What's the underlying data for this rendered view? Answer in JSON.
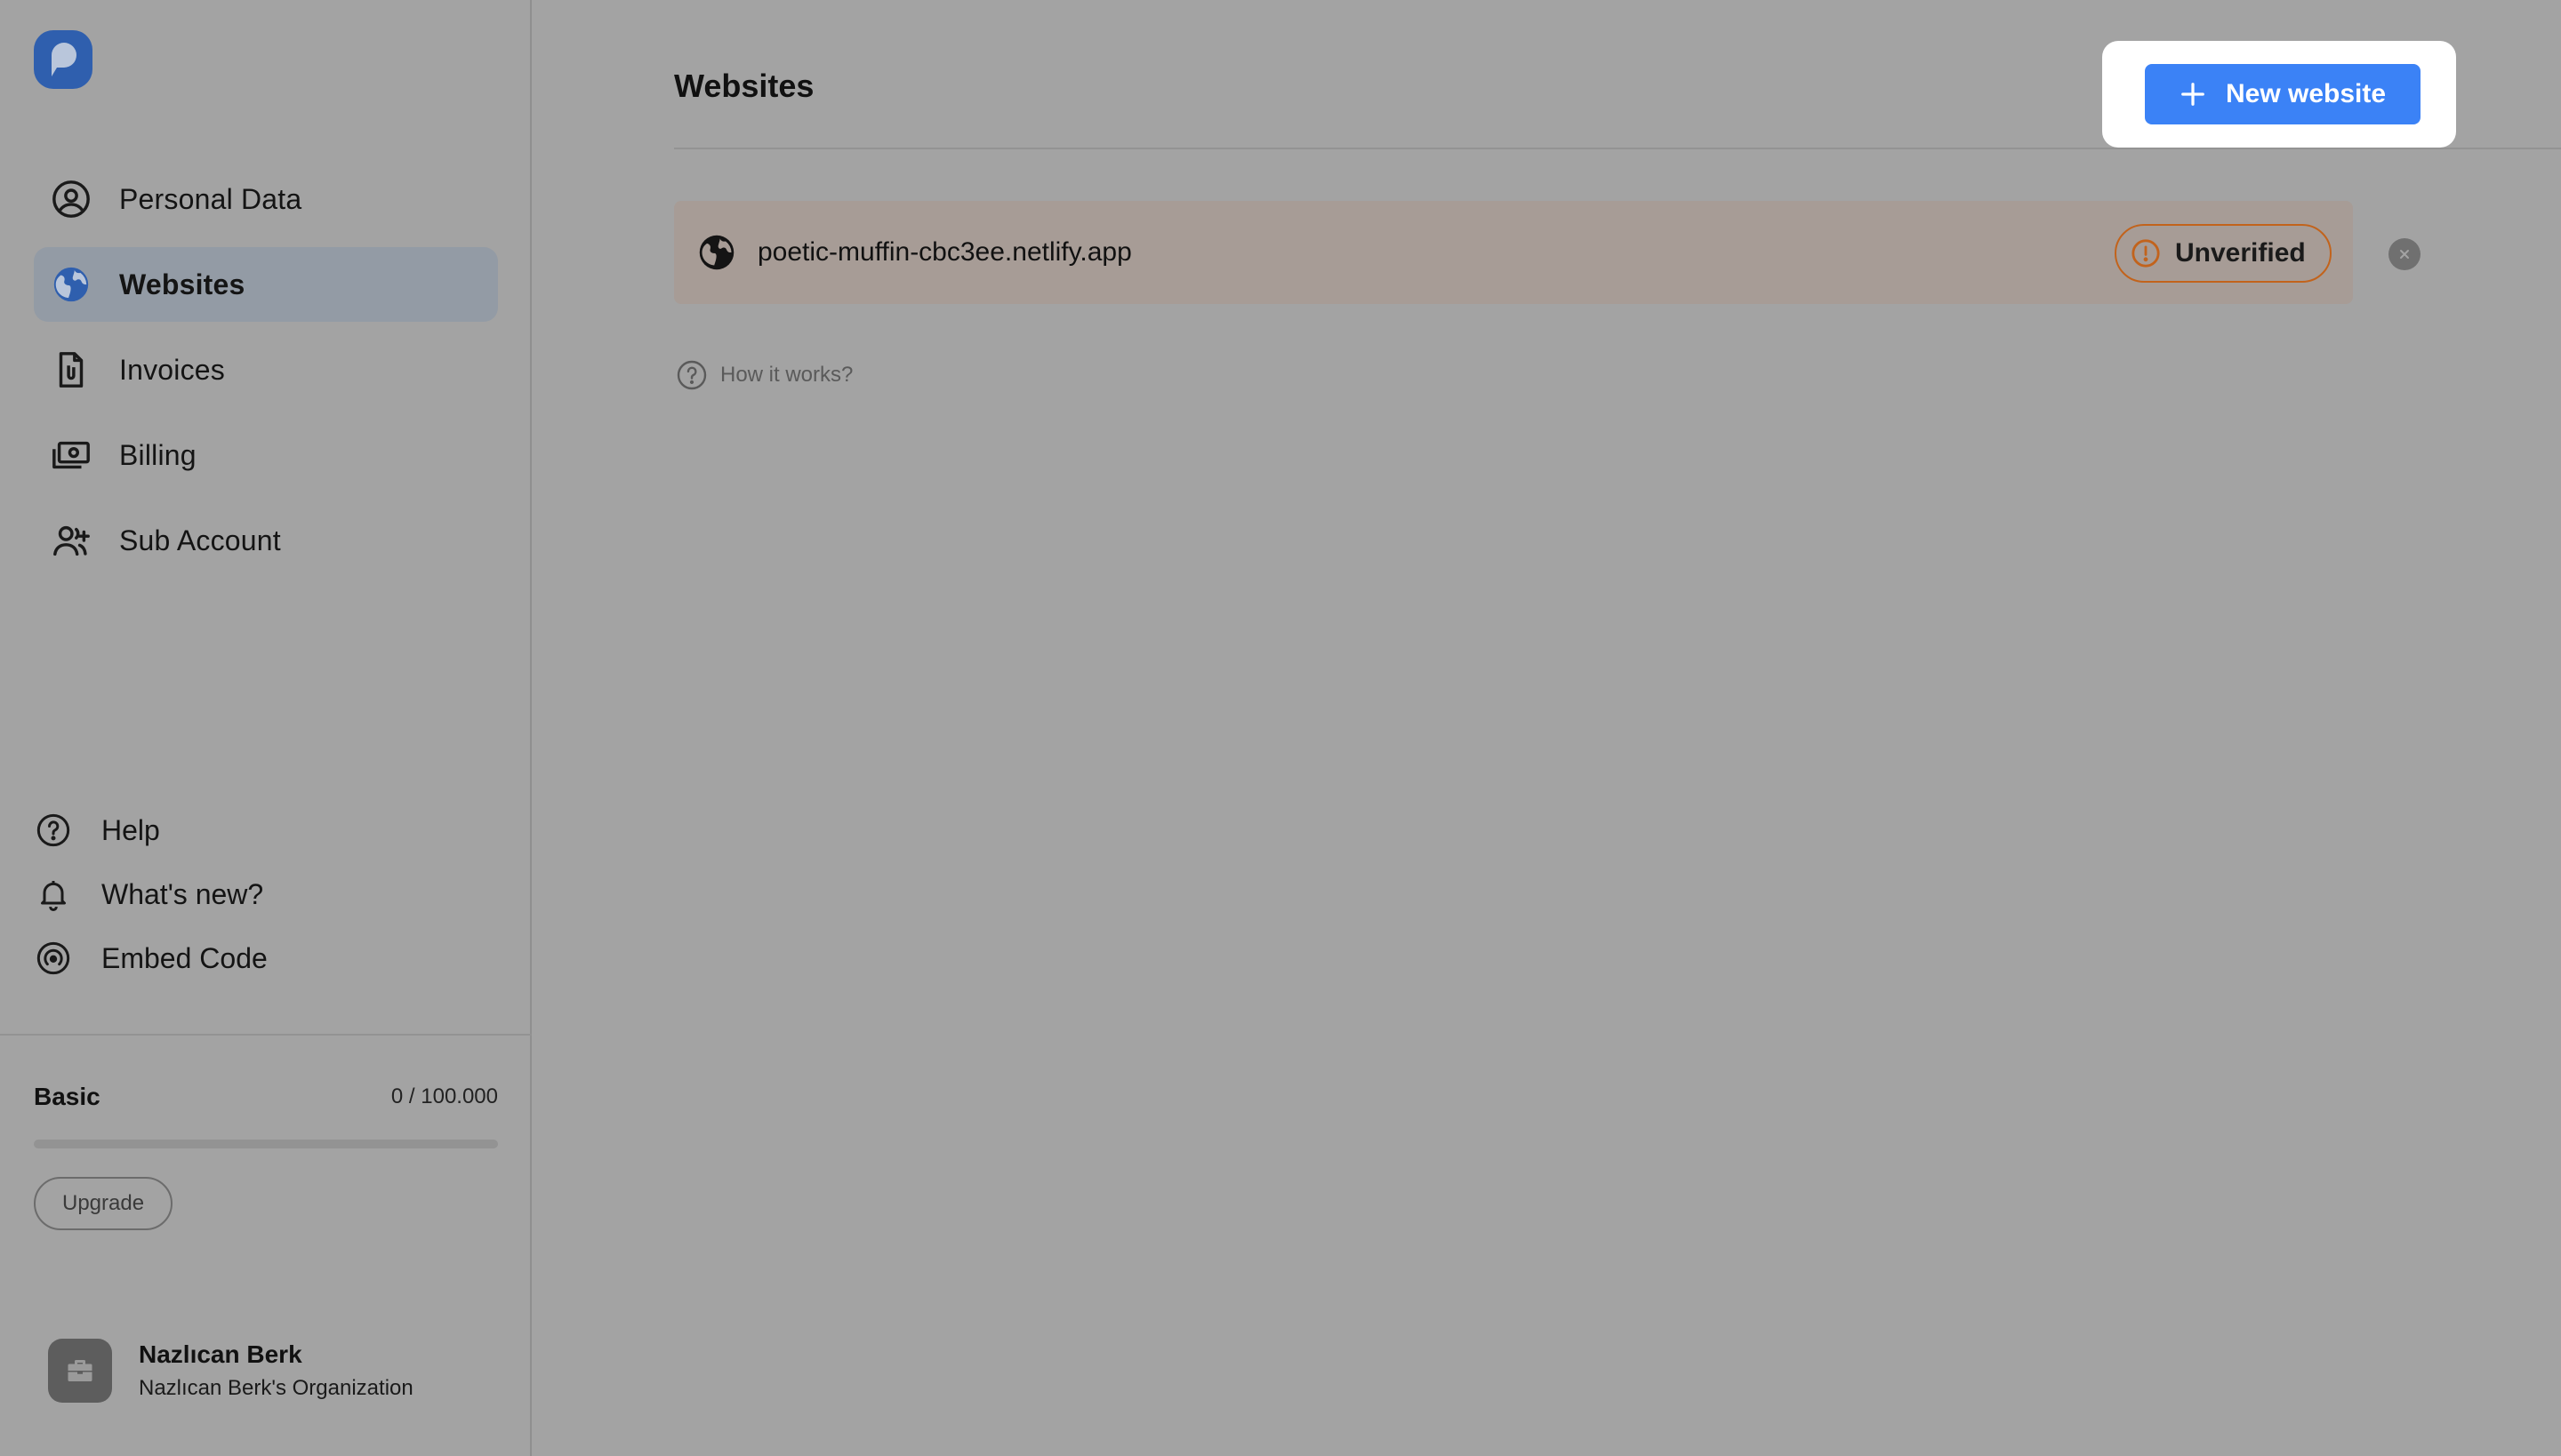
{
  "sidebar": {
    "logo_icon": "brand-logo-icon",
    "nav": [
      {
        "label": "Personal Data",
        "icon": "user-circle-icon",
        "active": false
      },
      {
        "label": "Websites",
        "icon": "globe-icon",
        "active": true
      },
      {
        "label": "Invoices",
        "icon": "document-clip-icon",
        "active": false
      },
      {
        "label": "Billing",
        "icon": "cash-icon",
        "active": false
      },
      {
        "label": "Sub Account",
        "icon": "user-add-icon",
        "active": false
      }
    ],
    "aux": [
      {
        "label": "Help",
        "icon": "question-circle-icon"
      },
      {
        "label": "What's new?",
        "icon": "bell-icon"
      },
      {
        "label": "Embed Code",
        "icon": "signal-icon"
      }
    ],
    "plan": {
      "name": "Basic",
      "usage": "0 / 100.000",
      "used_fraction": 0,
      "upgrade_label": "Upgrade"
    },
    "user": {
      "name": "Nazlıcan Berk",
      "organization": "Nazlıcan Berk's Organization",
      "avatar_icon": "briefcase-icon"
    }
  },
  "main": {
    "title": "Websites",
    "new_button_label": "New website",
    "websites": [
      {
        "url": "poetic-muffin-cbc3ee.netlify.app",
        "status": "Unverified",
        "status_icon": "exclamation-circle-icon"
      }
    ],
    "help_link": "How it works?"
  },
  "colors": {
    "accent": "#3b82f6",
    "overlay_background": "#a3a3a3",
    "warning": "#c2631c"
  }
}
